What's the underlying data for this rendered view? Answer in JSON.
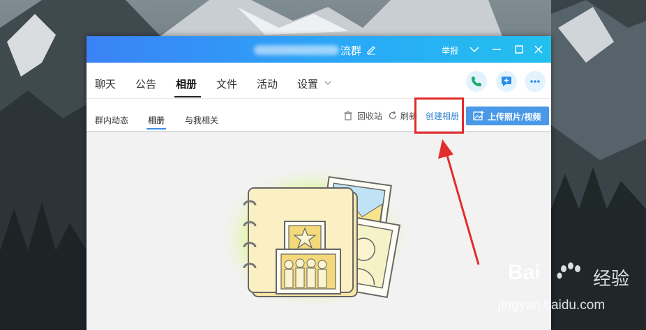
{
  "window": {
    "title_suffix": "流群",
    "report_label": "举报"
  },
  "tabs": {
    "items": [
      "聊天",
      "公告",
      "相册",
      "文件",
      "活动",
      "设置"
    ],
    "active": "相册"
  },
  "subtabs": {
    "items": [
      "群内动态",
      "相册",
      "与我相关"
    ],
    "active": "相册"
  },
  "actions": {
    "recycle_label": "回收站",
    "refresh_label": "刷新",
    "create_album_label": "创建相册",
    "upload_label": "上传照片/视频"
  },
  "watermark": {
    "brand": "Bai",
    "brand_suffix": "经验",
    "url": "jingyan.baidu.com"
  },
  "icons": {
    "titlebar": [
      "edit-icon",
      "menu-chevron-icon",
      "minimize-icon",
      "maximize-icon",
      "close-icon"
    ],
    "tabbar": [
      "phone-icon",
      "message-icon",
      "more-icon"
    ]
  },
  "colors": {
    "titlebar_start": "#3b82f6",
    "titlebar_end": "#22c1ee",
    "accent_blue": "#4a99e9",
    "highlight_red": "#e32b2b"
  }
}
